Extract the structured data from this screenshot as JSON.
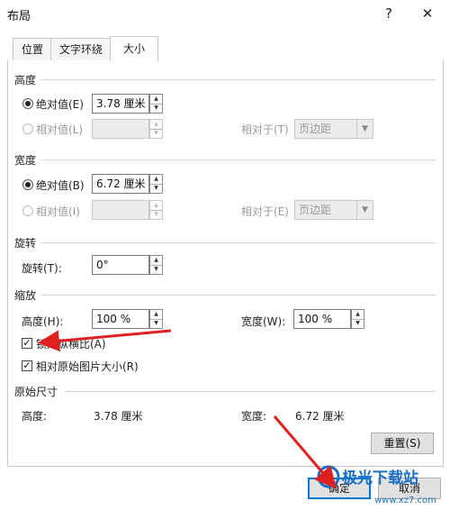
{
  "window": {
    "title": "布局",
    "help": "?",
    "close": "✕"
  },
  "tabs": [
    {
      "label": "位置"
    },
    {
      "label": "文字环绕"
    },
    {
      "label": "大小"
    }
  ],
  "height_section": {
    "title": "高度",
    "absolute_label": "绝对值(E)",
    "absolute_value": "3.78 厘米",
    "relative_label": "相对值(L)",
    "relative_value": "",
    "relative_to_label": "相对于(T)",
    "relative_to_value": "页边距"
  },
  "width_section": {
    "title": "宽度",
    "absolute_label": "绝对值(B)",
    "absolute_value": "6.72 厘米",
    "relative_label": "相对值(I)",
    "relative_value": "",
    "relative_to_label": "相对于(E)",
    "relative_to_value": "页边距"
  },
  "rotation_section": {
    "title": "旋转",
    "rotation_label": "旋转(T):",
    "rotation_value": "0°"
  },
  "scale_section": {
    "title": "缩放",
    "height_label": "高度(H):",
    "height_value": "100 %",
    "width_label": "宽度(W):",
    "width_value": "100 %",
    "lock_ratio_label": "锁定纵横比(A)",
    "lock_ratio_checked": true,
    "relative_original_label": "相对原始图片大小(R)",
    "relative_original_checked": true
  },
  "original_size_section": {
    "title": "原始尺寸",
    "height_label": "高度:",
    "height_value": "3.78 厘米",
    "width_label": "宽度:",
    "width_value": "6.72 厘米",
    "reset_label": "重置(S)"
  },
  "footer": {
    "ok_label": "确定",
    "cancel_label": "取消"
  },
  "watermark": {
    "brand": "极光下载站",
    "url": "www.xz7.com"
  },
  "colors": {
    "accent": "#0078d7",
    "annotation_arrow": "#e02020"
  }
}
